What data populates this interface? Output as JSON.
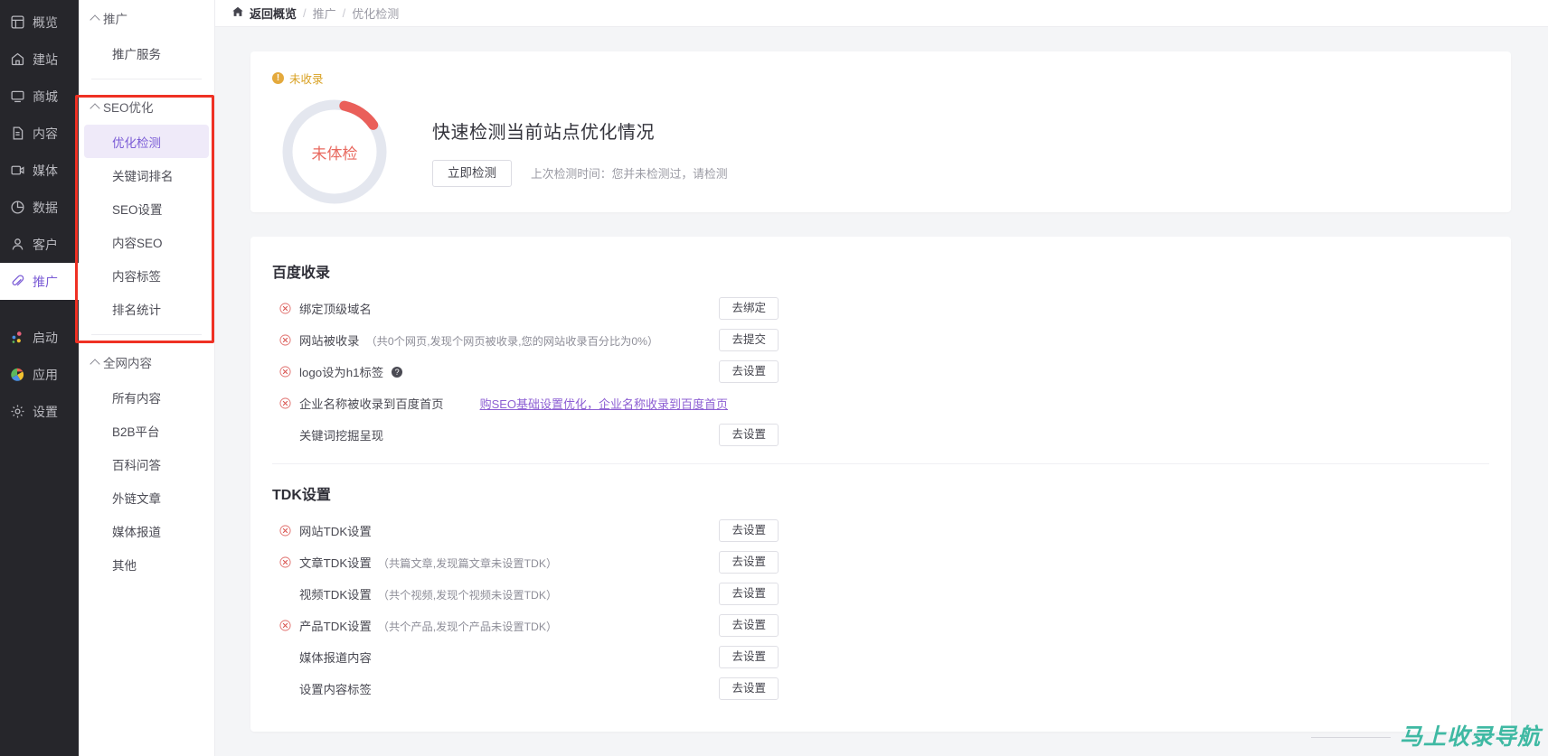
{
  "rail": {
    "items": [
      {
        "label": "概览",
        "icon": "grid-icon",
        "active": false
      },
      {
        "label": "建站",
        "icon": "home-icon",
        "active": false
      },
      {
        "label": "商城",
        "icon": "shop-icon",
        "active": false
      },
      {
        "label": "内容",
        "icon": "document-icon",
        "active": false
      },
      {
        "label": "媒体",
        "icon": "media-icon",
        "active": false
      },
      {
        "label": "数据",
        "icon": "chart-pie-icon",
        "active": false
      },
      {
        "label": "客户",
        "icon": "user-icon",
        "active": false
      },
      {
        "label": "推广",
        "icon": "paperclip-icon",
        "active": true
      }
    ],
    "bottom_items": [
      {
        "label": "启动",
        "icon": "launch-icon"
      },
      {
        "label": "应用",
        "icon": "apps-icon"
      },
      {
        "label": "设置",
        "icon": "gear-icon"
      }
    ]
  },
  "subnav": {
    "groups": [
      {
        "title": "推广",
        "items": [
          {
            "label": "推广服务",
            "active": false
          }
        ]
      },
      {
        "title": "SEO优化",
        "items": [
          {
            "label": "优化检测",
            "active": true
          },
          {
            "label": "关键词排名",
            "active": false
          },
          {
            "label": "SEO设置",
            "active": false
          },
          {
            "label": "内容SEO",
            "active": false
          },
          {
            "label": "内容标签",
            "active": false
          },
          {
            "label": "排名统计",
            "active": false
          }
        ]
      },
      {
        "title": "全网内容",
        "items": [
          {
            "label": "所有内容",
            "active": false
          },
          {
            "label": "B2B平台",
            "active": false
          },
          {
            "label": "百科问答",
            "active": false
          },
          {
            "label": "外链文章",
            "active": false
          },
          {
            "label": "媒体报道",
            "active": false
          },
          {
            "label": "其他",
            "active": false
          }
        ]
      }
    ]
  },
  "breadcrumb": {
    "home": "返回概览",
    "sep": "/",
    "level1": "推广",
    "level2": "优化检测"
  },
  "detect_card": {
    "badge": "未收录",
    "gauge_text": "未体检",
    "gauge_percent": 12,
    "gauge_color": "#ea5f5a",
    "gauge_track": "#e3e6ef",
    "title": "快速检测当前站点优化情况",
    "button": "立即检测",
    "last_time": "上次检测时间：您并未检测过，请检测"
  },
  "sections": [
    {
      "title": "百度收录",
      "rows": [
        {
          "status": "fail",
          "label": "绑定顶级域名",
          "note": "",
          "help": false,
          "action": "去绑定",
          "link": ""
        },
        {
          "status": "fail",
          "label": "网站被收录",
          "note": "（共0个网页,发现个网页被收录,您的网站收录百分比为0%）",
          "help": false,
          "action": "去提交",
          "link": ""
        },
        {
          "status": "fail",
          "label": "logo设为h1标签",
          "note": "",
          "help": true,
          "action": "去设置",
          "link": ""
        },
        {
          "status": "fail",
          "label": "企业名称被收录到百度首页",
          "note": "",
          "help": false,
          "action": "",
          "link": "购SEO基础设置优化，企业名称收录到百度首页"
        },
        {
          "status": "none",
          "label": "关键词挖掘呈现",
          "note": "",
          "help": false,
          "action": "去设置",
          "link": ""
        }
      ]
    },
    {
      "title": "TDK设置",
      "rows": [
        {
          "status": "fail",
          "label": "网站TDK设置",
          "note": "",
          "help": false,
          "action": "去设置",
          "link": ""
        },
        {
          "status": "fail",
          "label": "文章TDK设置",
          "note": "（共篇文章,发现篇文章未设置TDK）",
          "help": false,
          "action": "去设置",
          "link": ""
        },
        {
          "status": "none",
          "label": "视频TDK设置",
          "note": "（共个视频,发现个视频未设置TDK）",
          "help": false,
          "action": "去设置",
          "link": ""
        },
        {
          "status": "fail",
          "label": "产品TDK设置",
          "note": "（共个产品,发现个产品未设置TDK）",
          "help": false,
          "action": "去设置",
          "link": ""
        },
        {
          "status": "none",
          "label": "媒体报道内容",
          "note": "",
          "help": false,
          "action": "去设置",
          "link": ""
        },
        {
          "status": "none",
          "label": "设置内容标签",
          "note": "",
          "help": false,
          "action": "去设置",
          "link": ""
        }
      ]
    }
  ],
  "watermark": {
    "text": "马上收录导航",
    "color": "#3fb9a3"
  },
  "theme": {
    "accent": "#7b5cd6",
    "highlight_box": "#ef3124",
    "warn": "#d9a123",
    "fail": "#e86a6a"
  }
}
